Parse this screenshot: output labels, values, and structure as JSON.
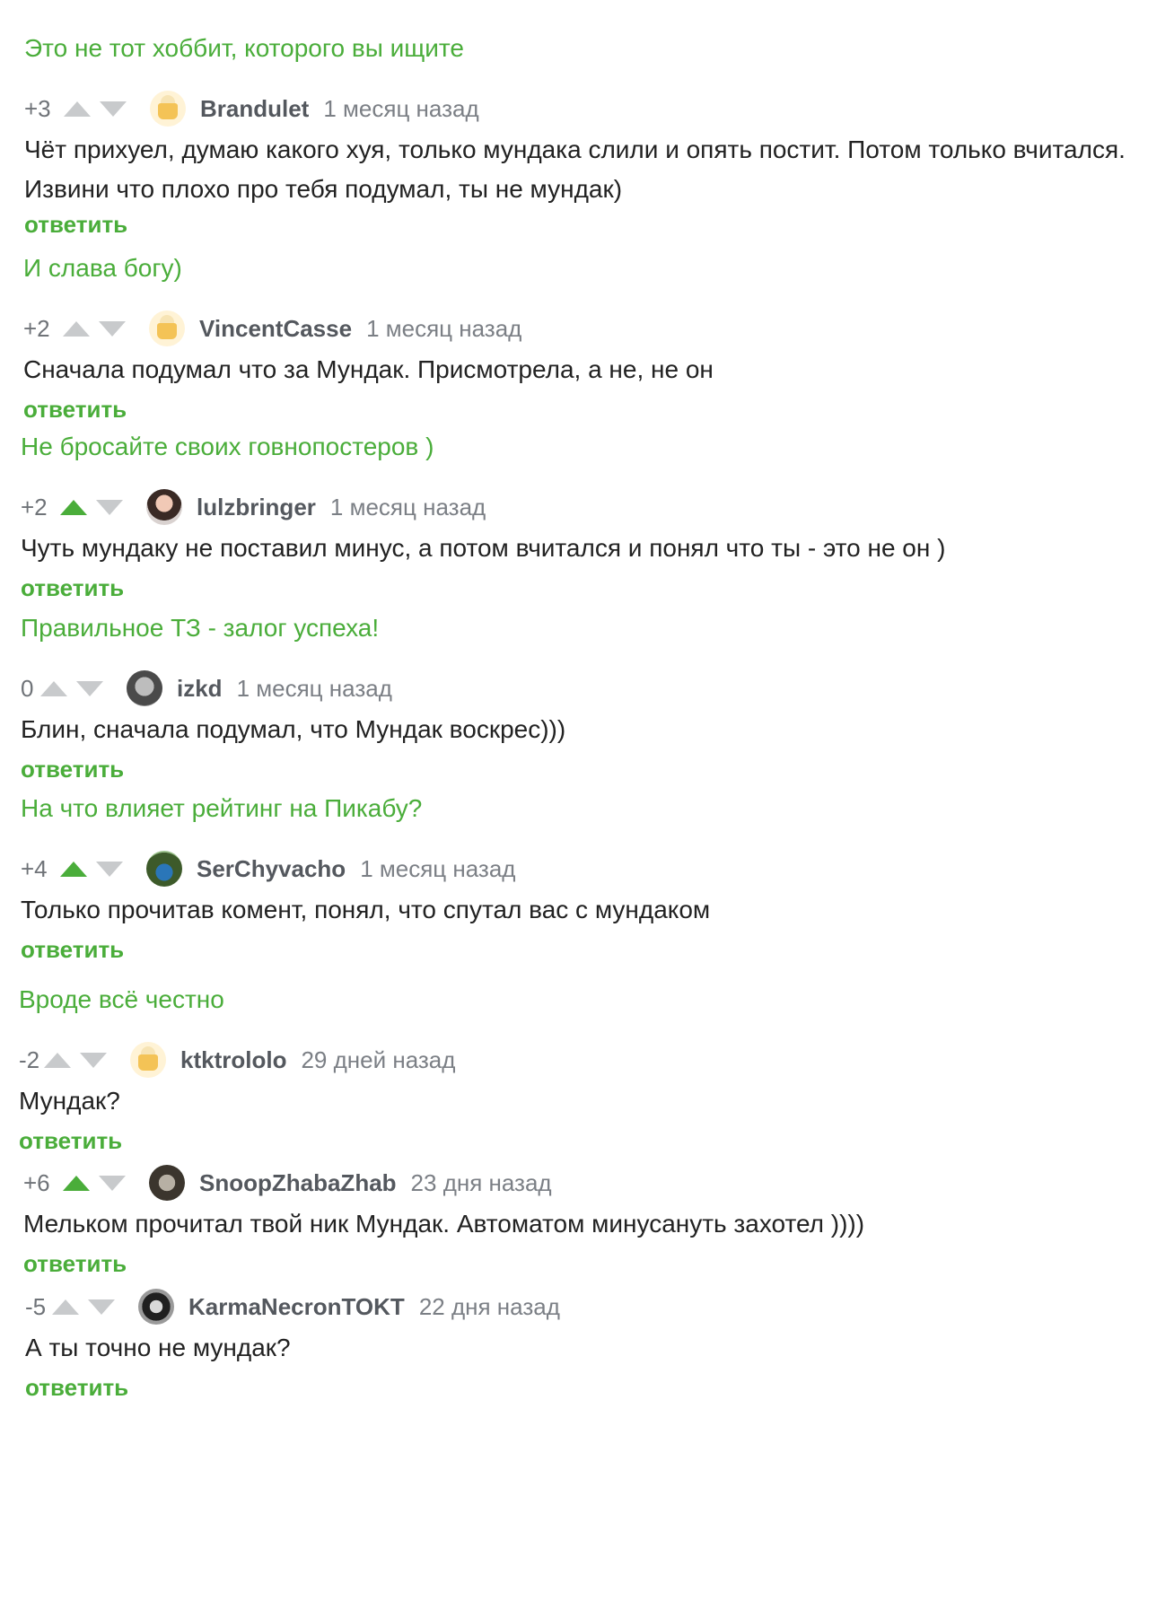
{
  "thread_links": [
    "Это не тот хоббит, которого вы ищите",
    "И слава богу)",
    "Не бросайте своих говнопостеров )",
    "Правильное ТЗ - залог успеха!",
    "На что влияет рейтинг на Пикабу?",
    "Вроде всё честно"
  ],
  "reply_label": "ответить",
  "colors": {
    "accent": "#4aad3a",
    "vote_inactive": "#c8cacc",
    "text": "#222222",
    "meta": "#7b7f85"
  },
  "comments": [
    {
      "rating": "+3",
      "upvoted": false,
      "avatar": "default-cheese-avatar",
      "user": "Brandulet",
      "time": "1 месяц назад",
      "lines": [
        "Чёт прихуел, думаю какого хуя, только мундака слили и опять постит. Потом только вчитался.",
        "Извини что плохо про тебя подумал, ты не мундак)"
      ]
    },
    {
      "rating": "+2",
      "upvoted": false,
      "avatar": "default-cheese-avatar",
      "user": "VincentCasse",
      "time": "1 месяц назад",
      "lines": [
        "Сначала подумал что за Мундак. Присмотрела, а не, не он"
      ]
    },
    {
      "rating": "+2",
      "upvoted": true,
      "avatar": "user-photo-avatar",
      "user": "lulzbringer",
      "time": "1 месяц назад",
      "lines": [
        "Чуть мундаку не поставил минус, а потом вчитался и понял что ты - это не он )"
      ]
    },
    {
      "rating": "0",
      "upvoted": false,
      "avatar": "user-photo-avatar",
      "user": "izkd",
      "time": "1 месяц назад",
      "lines": [
        "Блин, сначала подумал, что Мундак воскрес)))"
      ]
    },
    {
      "rating": "+4",
      "upvoted": true,
      "avatar": "user-photo-avatar",
      "user": "SerChyvacho",
      "time": "1 месяц назад",
      "lines": [
        "Только прочитав комент, понял, что спутал вас с мундаком"
      ]
    },
    {
      "rating": "-2",
      "upvoted": false,
      "avatar": "default-cheese-avatar",
      "user": "ktktrololo",
      "time": "29 дней назад",
      "lines": [
        "Мундак?"
      ]
    },
    {
      "rating": "+6",
      "upvoted": true,
      "avatar": "user-photo-avatar",
      "user": "SnoopZhabaZhab",
      "time": "23 дня назад",
      "lines": [
        "Мельком прочитал твой ник Мундак. Автоматом минусануть захотел ))))"
      ]
    },
    {
      "rating": "-5",
      "upvoted": false,
      "avatar": "user-photo-avatar",
      "user": "KarmaNecronTOKT",
      "time": "22 дня назад",
      "lines": [
        "А ты точно не мундак?"
      ]
    }
  ]
}
